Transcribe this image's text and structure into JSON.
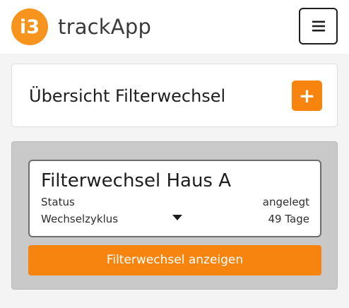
{
  "header": {
    "logo_text": "i3",
    "app_name": "trackApp",
    "menu_icon": "hamburger-menu-icon"
  },
  "overview": {
    "title": "Übersicht Filterwechsel",
    "add_label": "+"
  },
  "filter_cards": [
    {
      "name": "Filterwechsel Haus A",
      "status_label": "Status",
      "status_value": "angelegt",
      "cycle_label": "Wechselzyklus",
      "cycle_value": "49 Tage",
      "show_button": "Filterwechsel anzeigen"
    }
  ],
  "colors": {
    "accent": "#f7840f",
    "logo": "#f7941d",
    "panel": "#c9c9c9",
    "background": "#f4f4f4"
  }
}
